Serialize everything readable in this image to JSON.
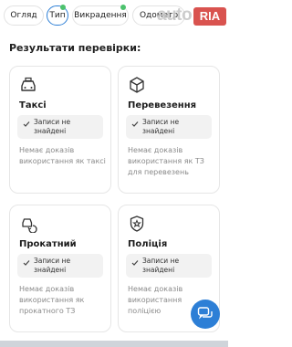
{
  "tabs": [
    {
      "label": "Огляд",
      "active": false,
      "dot": false
    },
    {
      "label": "Тип",
      "active": true,
      "dot": true
    },
    {
      "label": "Викрадення",
      "active": false,
      "dot": true
    },
    {
      "label": "Одометр",
      "active": false,
      "dot": false
    }
  ],
  "watermark": {
    "text": "auto",
    "badge": "RIA"
  },
  "results": {
    "title": "Результати перевірки:",
    "cards": [
      {
        "icon": "taxi-icon",
        "title": "Таксі",
        "badge": "Записи не знайдені",
        "description": "Немає доказів використання як таксі"
      },
      {
        "icon": "box-icon",
        "title": "Перевезення",
        "badge": "Записи не знайдені",
        "description": "Немає доказів використання як ТЗ для перевезень"
      },
      {
        "icon": "rental-car-icon",
        "title": "Прокатний",
        "badge": "Записи не знайдені",
        "description": "Немає доказів використання як прокатного ТЗ"
      },
      {
        "icon": "police-badge-icon",
        "title": "Поліція",
        "badge": "Записи не знайдені",
        "description": "Немає доказів використання поліцією"
      }
    ]
  },
  "chat_button": {
    "icon": "chat-icon"
  },
  "colors": {
    "accent": "#2d7fd6",
    "status_dot": "#4cc26d",
    "watermark_badge": "#d9534f"
  }
}
